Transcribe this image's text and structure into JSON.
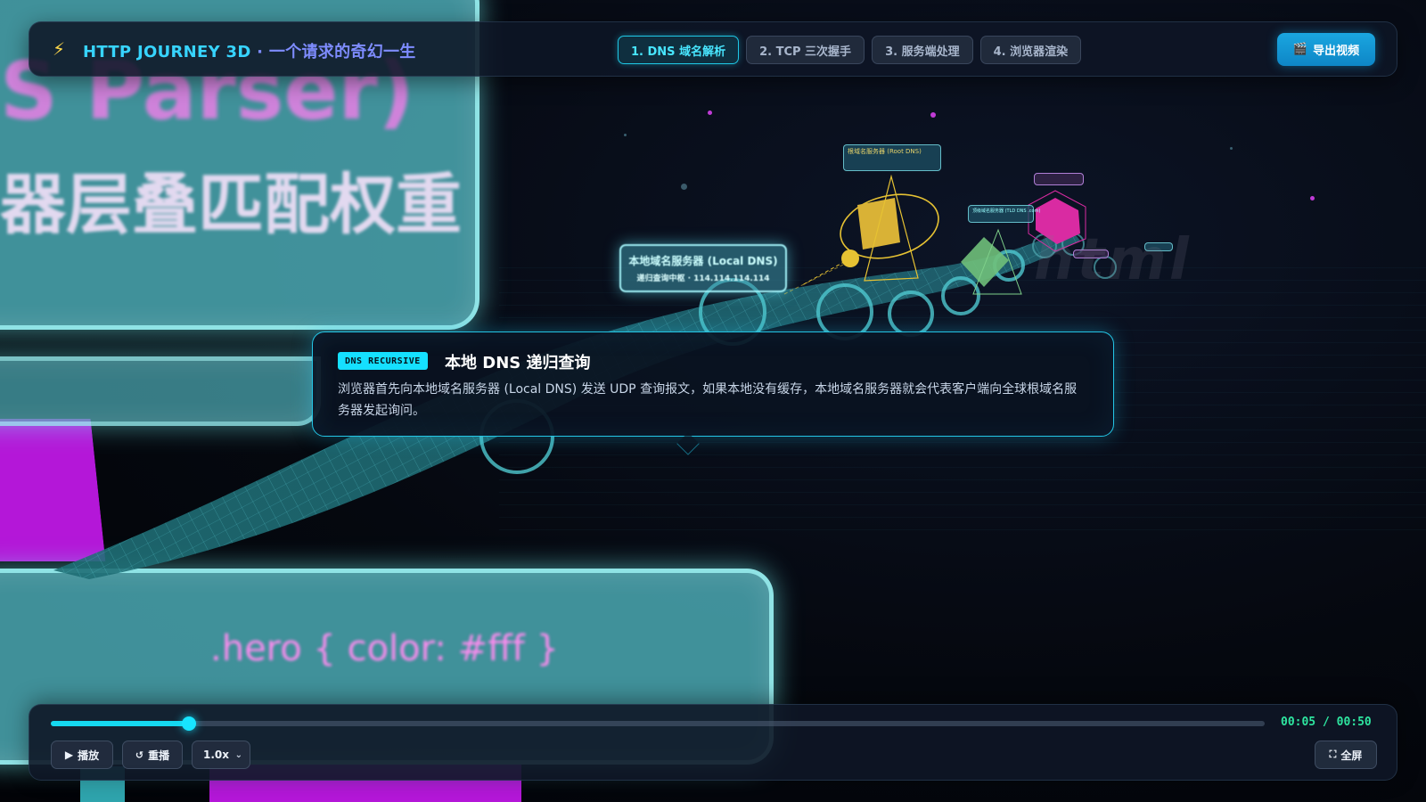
{
  "header": {
    "logo_icon": "lightning-icon",
    "title_en": "HTTP JOURNEY 3D",
    "title_sep": " · ",
    "title_cn": "一个请求的奇幻一生",
    "tabs": [
      {
        "label": "1. DNS 域名解析",
        "active": true
      },
      {
        "label": "2. TCP 三次握手",
        "active": false
      },
      {
        "label": "3. 服务端处理",
        "active": false
      },
      {
        "label": "4. 浏览器渲染",
        "active": false
      }
    ],
    "export_icon": "clapperboard-icon",
    "export_label": "导出视频"
  },
  "scene": {
    "panel_top_line1": "S Parser)",
    "panel_top_line2": "器层叠匹配权重",
    "panel_bottom_code": ".hero { color: #fff }",
    "node_label_title": "本地域名服务器 (Local DNS)",
    "node_label_sub": "递归查询中枢 · 114.114.114.114",
    "small_label_1": "根域名服务器 (Root DNS)",
    "small_label_2": "顶级域名服务器 (TLD DNS .com)",
    "ghost_text": "html"
  },
  "info_card": {
    "badge": "DNS RECURSIVE",
    "title": "本地 DNS 递归查询",
    "description": "浏览器首先向本地域名服务器 (Local DNS) 发送 UDP 查询报文，如果本地没有缓存，本地域名服务器就会代表客户端向全球根域名服务器发起询问。"
  },
  "player": {
    "progress": 0.114,
    "time_current": "00:05",
    "time_sep": " / ",
    "time_total": "00:50",
    "play_icon": "play-icon",
    "play_label": "播放",
    "replay_icon": "replay-icon",
    "replay_label": "重播",
    "speed_value": "1.0x",
    "fullscreen_icon": "fullscreen-icon",
    "fullscreen_label": "全屏"
  },
  "colors": {
    "accent": "#15e0ff",
    "brand_gradient_end": "#7e8cff",
    "timecode": "#2ee6a0",
    "magenta": "#b417d8",
    "panel_teal": "#4eb0ba"
  }
}
